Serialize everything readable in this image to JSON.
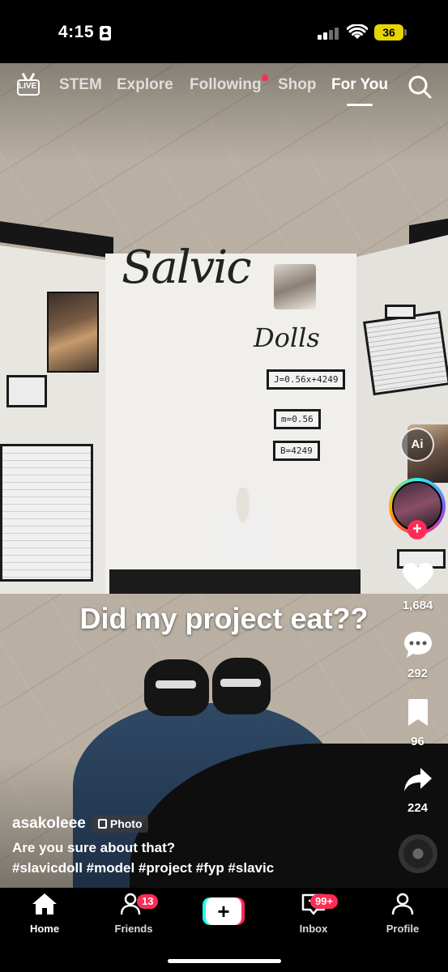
{
  "status_bar": {
    "time": "4:15",
    "battery": "36"
  },
  "top_nav": {
    "live_label": "LIVE",
    "items": [
      {
        "label": "STEM"
      },
      {
        "label": "Explore"
      },
      {
        "label": "Following"
      },
      {
        "label": "Shop"
      },
      {
        "label": "For You"
      }
    ],
    "active": "For You"
  },
  "post": {
    "overlay_text": "Did my project eat??",
    "board_title": "Salvic",
    "board_subtitle": "Dolls",
    "formulas": [
      "J=0.56x+4249",
      "m=0.56",
      "B=4249"
    ],
    "username": "asakoleee",
    "media_type": "Photo",
    "description": "Are you sure about that?",
    "hashtags": "#slavicdoll #model #project #fyp #slavic"
  },
  "actions": {
    "ai_label": "Ai",
    "likes": "1,684",
    "comments": "292",
    "saves": "96",
    "shares": "224"
  },
  "bottom_nav": {
    "home": "Home",
    "friends": "Friends",
    "friends_badge": "13",
    "create": "+",
    "inbox": "Inbox",
    "inbox_badge": "99+",
    "profile": "Profile"
  },
  "colors": {
    "accent_red": "#fe2c55",
    "accent_cyan": "#25f4ee",
    "battery": "#e6d400"
  }
}
